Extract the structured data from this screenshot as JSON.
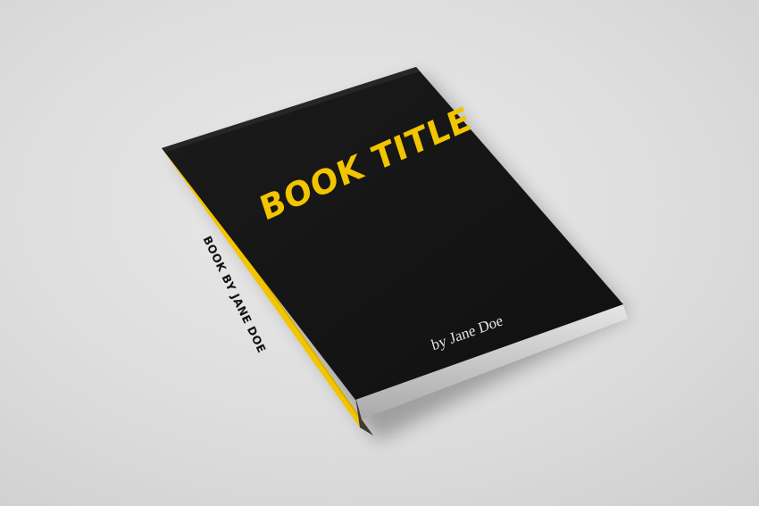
{
  "book": {
    "cover_title": "BOOK TITLE",
    "cover_author": "by Jane Doe",
    "spine_text": "BOOK BY JANE DOE"
  },
  "colors": {
    "cover": "#141414",
    "accent_yellow": "#f2c500",
    "author_text": "#e6e6e6",
    "background": "#dadada",
    "page_edges": "#cfcfcf"
  }
}
